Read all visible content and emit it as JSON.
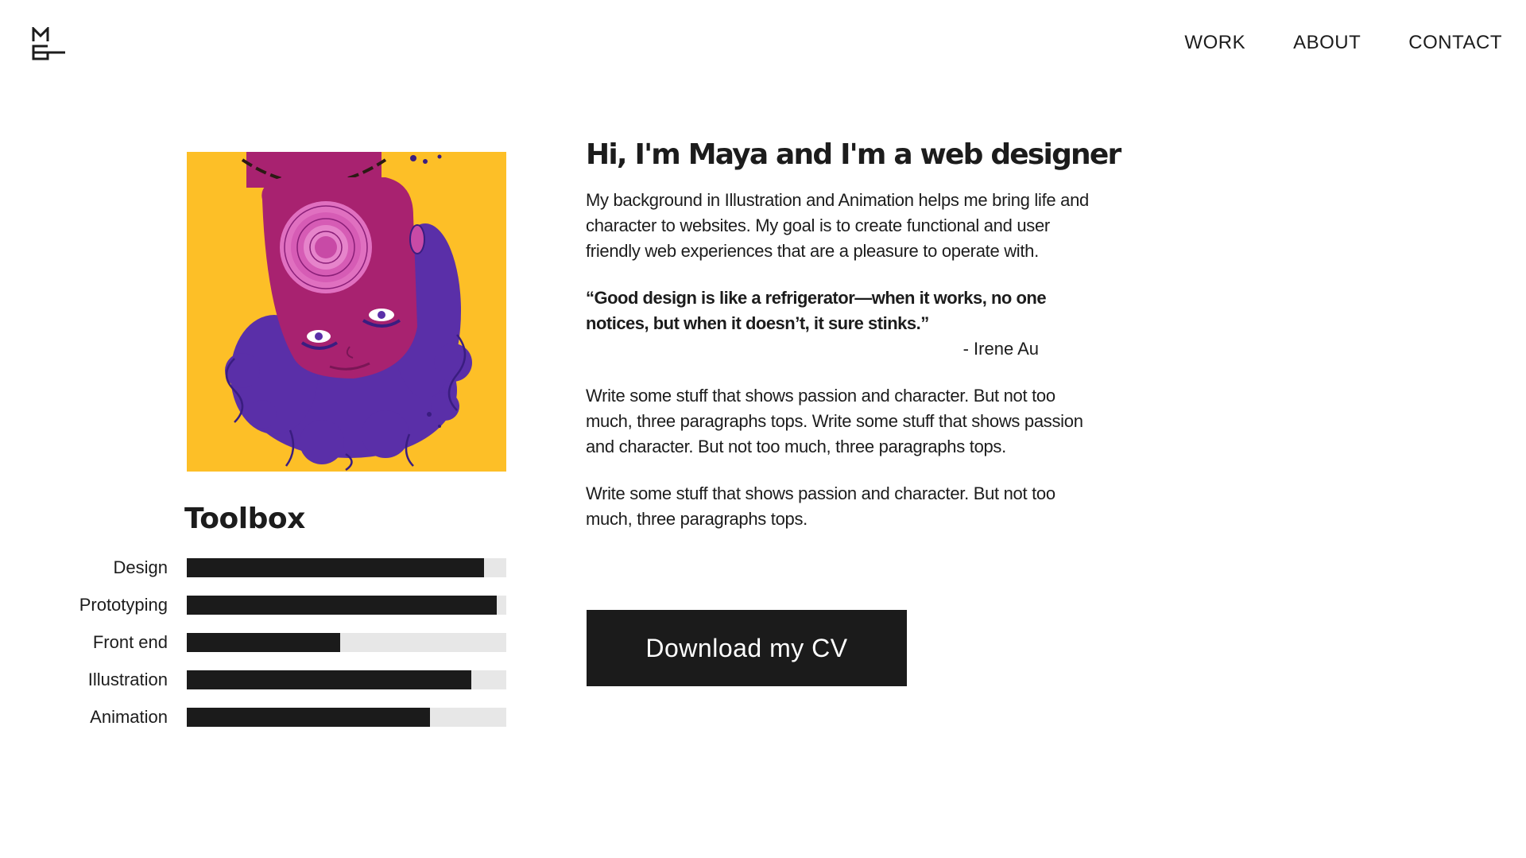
{
  "header": {
    "logo_icon": "mg-monogram-logo",
    "nav": [
      {
        "label": "WORK"
      },
      {
        "label": "ABOUT"
      },
      {
        "label": "CONTACT"
      }
    ]
  },
  "portrait": {
    "icon": "upside-down-illustrated-portrait",
    "background_color": "#fdbf27"
  },
  "main": {
    "headline": "Hi, I'm Maya and I'm a web designer",
    "intro": "My background in Illustration and Animation helps me bring life and character to websites. My goal is to create functional and user friendly web experiences that are a pleasure to operate with.",
    "quote": {
      "text": "“Good design is like a refrigerator—when it works, no one notices, but when it doesn’t, it sure stinks.”",
      "author": "- Irene Au"
    },
    "paragraph_2": "Write some stuff that shows passion and character. But not too much, three paragraphs tops. Write some stuff that shows passion and character. But not too much, three paragraphs tops.",
    "paragraph_3": "Write some stuff that shows passion and character. But not too much, three paragraphs tops.",
    "cv_button_label": "Download my CV"
  },
  "toolbox": {
    "title": "Toolbox",
    "skills": [
      {
        "label": "Design",
        "level": 0.93
      },
      {
        "label": "Prototyping",
        "level": 0.97
      },
      {
        "label": "Front end",
        "level": 0.48
      },
      {
        "label": "Illustration",
        "level": 0.89
      },
      {
        "label": "Animation",
        "level": 0.76
      }
    ]
  },
  "colors": {
    "text": "#1c1c1c",
    "bar_fill": "#1b1b1b",
    "bar_track": "#e7e7e7",
    "accent_yellow": "#fdbf27"
  }
}
